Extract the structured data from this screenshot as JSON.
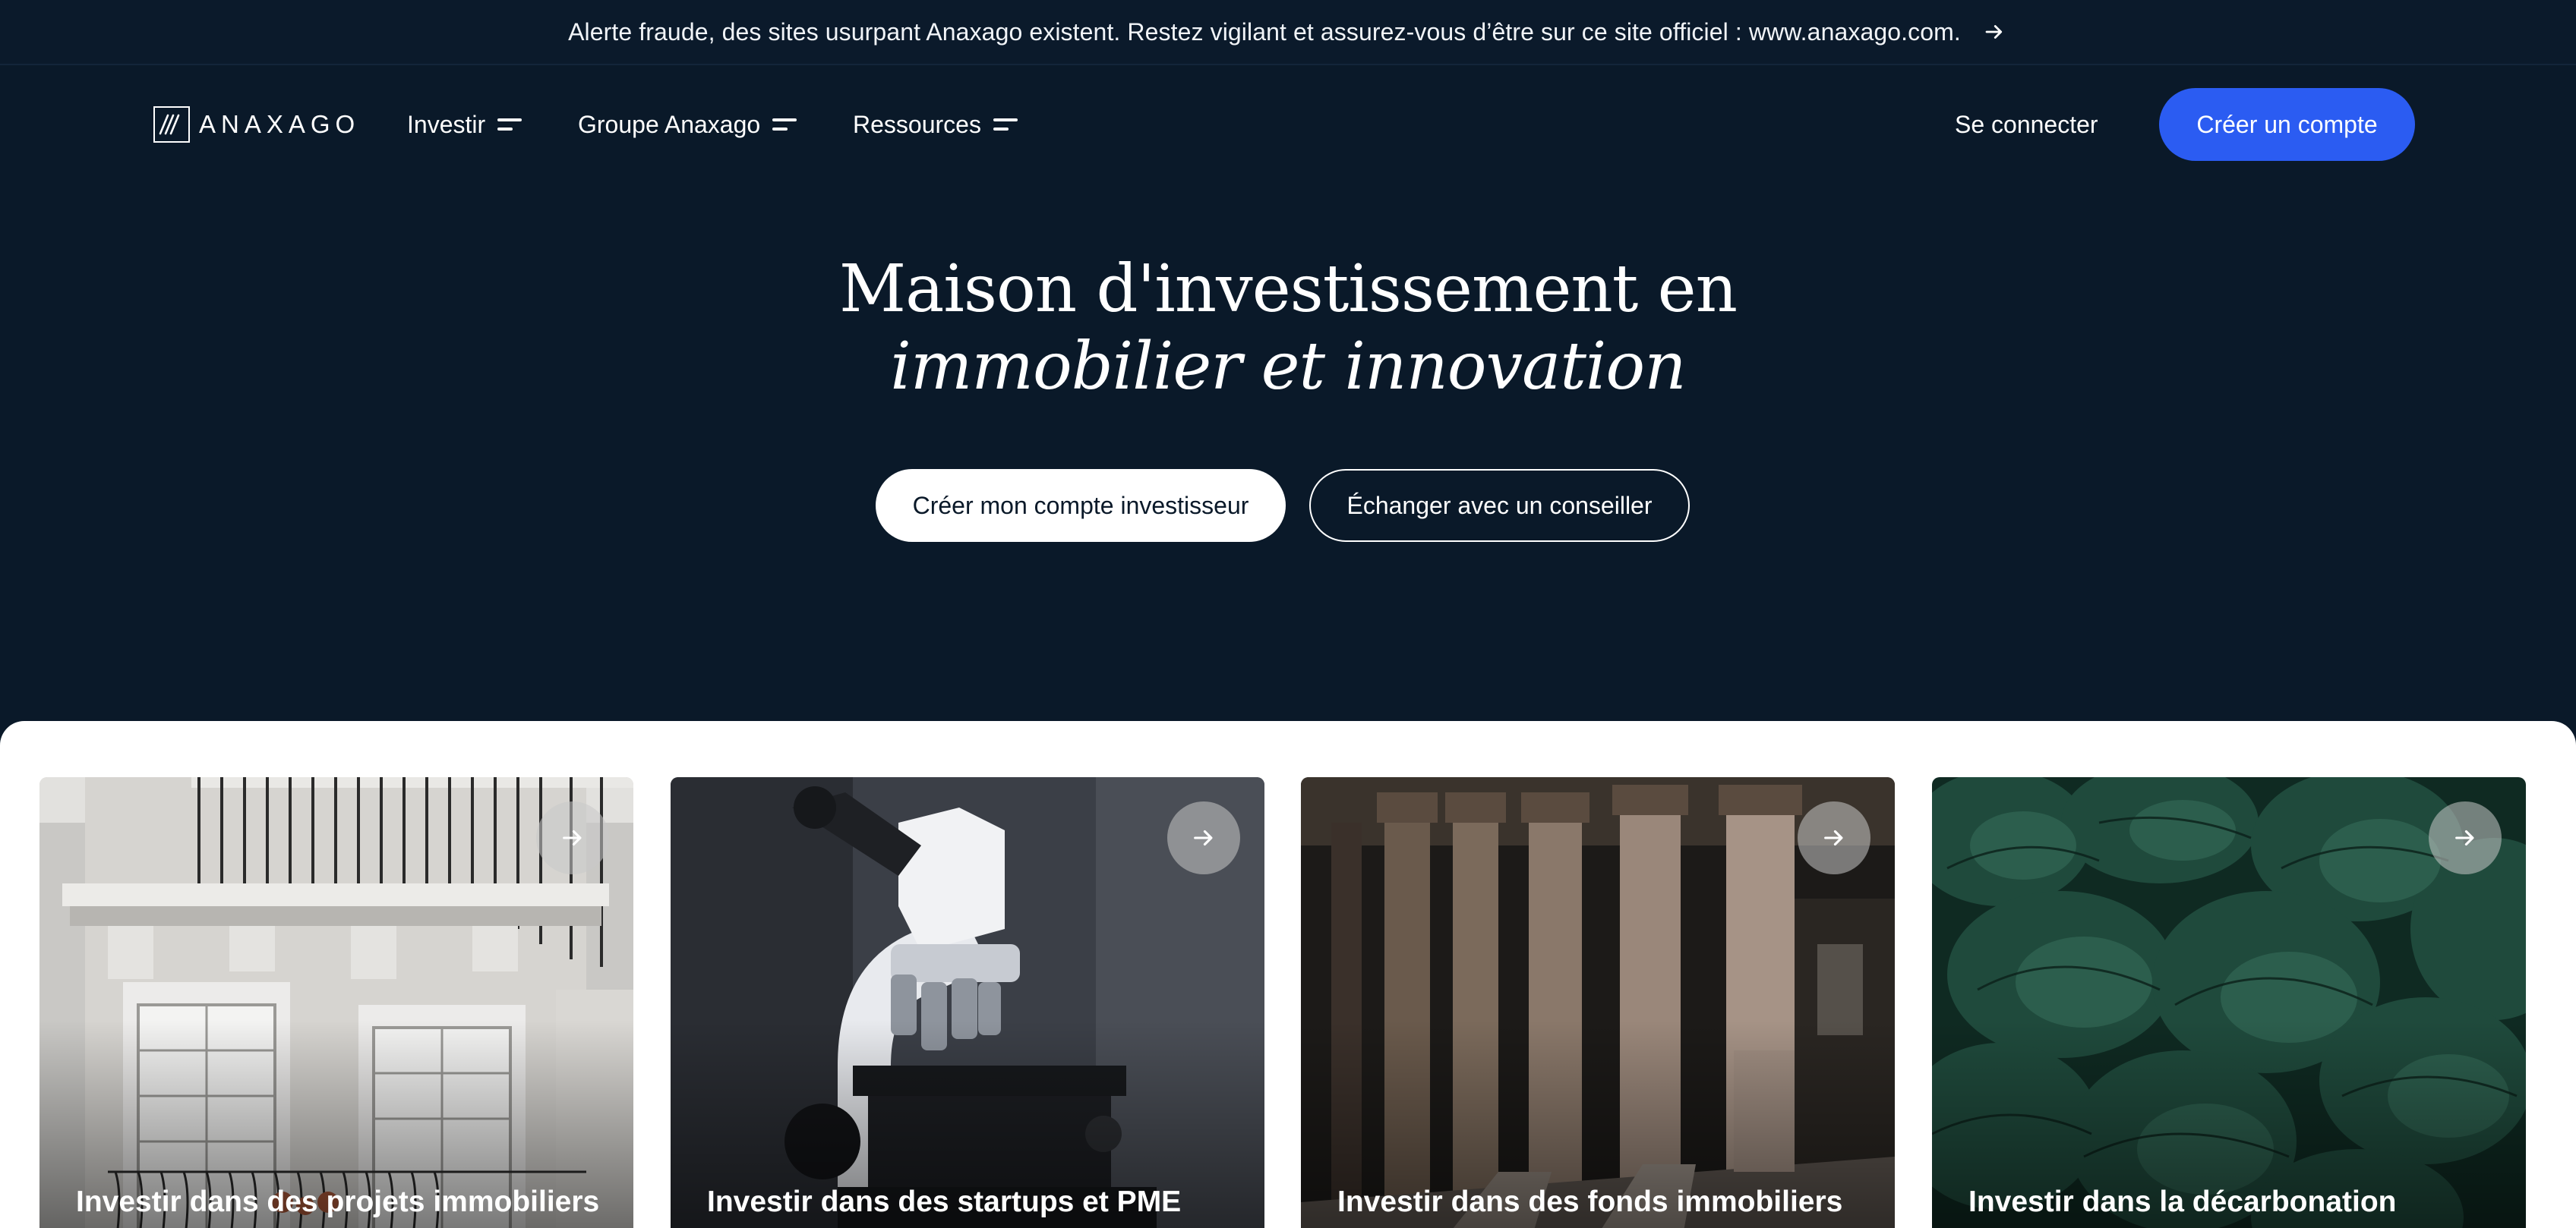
{
  "alert": {
    "text": "Alerte fraude, des sites usurpant Anaxago existent. Restez vigilant et assurez-vous d’être sur ce site officiel : www.anaxago.com."
  },
  "nav": {
    "logo_text": "ANAXAGO",
    "items": [
      {
        "label": "Investir"
      },
      {
        "label": "Groupe Anaxago"
      },
      {
        "label": "Ressources"
      }
    ],
    "login_label": "Se connecter",
    "signup_label": "Créer un compte"
  },
  "hero": {
    "title_line1": "Maison d'investissement en",
    "title_line2": "immobilier et innovation",
    "primary_cta": "Créer mon compte investisseur",
    "secondary_cta": "Échanger avec un conseiller"
  },
  "cards": [
    {
      "label": "Investir dans des projets immobiliers"
    },
    {
      "label": "Investir dans des startups et PME"
    },
    {
      "label": "Investir dans des fonds immobiliers"
    },
    {
      "label": "Investir dans la décarbonation"
    }
  ],
  "colors": {
    "background": "#0a1929",
    "accent": "#2b5cf2",
    "white": "#ffffff"
  }
}
